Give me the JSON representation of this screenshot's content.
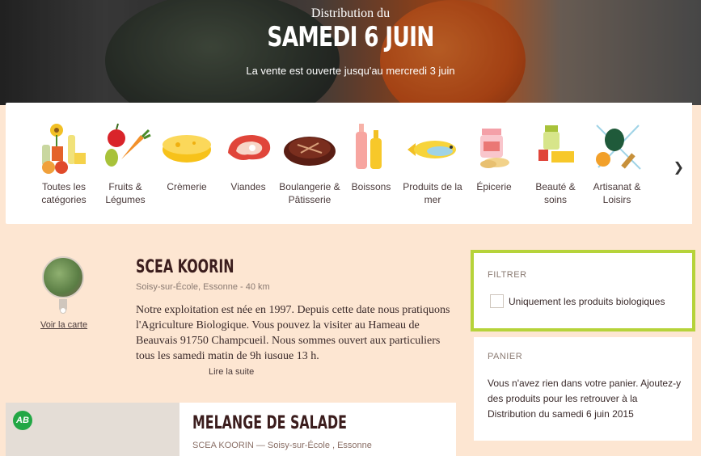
{
  "hero": {
    "kicker": "Distribution du",
    "title": "SAMEDI 6 JUIN",
    "subtitle": "La vente est ouverte jusqu'au mercredi 3 juin"
  },
  "categories": [
    {
      "label": "Toutes les catégories",
      "icon": "all-categories-icon"
    },
    {
      "label": "Fruits & Légumes",
      "icon": "fruits-vegetables-icon"
    },
    {
      "label": "Crèmerie",
      "icon": "cheese-icon"
    },
    {
      "label": "Viandes",
      "icon": "meat-icon"
    },
    {
      "label": "Boulangerie & Pâtisserie",
      "icon": "bread-icon"
    },
    {
      "label": "Boissons",
      "icon": "bottles-icon"
    },
    {
      "label": "Produits de la mer",
      "icon": "fish-icon"
    },
    {
      "label": "Épicerie",
      "icon": "jar-icon"
    },
    {
      "label": "Beauté & soins",
      "icon": "beauty-icon"
    },
    {
      "label": "Artisanat & Loisirs",
      "icon": "crafts-icon"
    }
  ],
  "producer": {
    "name": "SCEA KOORIN",
    "location": "Soisy-sur-École, Essonne - 40 km",
    "map_link": "Voir la carte",
    "description": "Notre exploitation est née en 1997. Depuis cette date nous pratiquons l'Agriculture Biologique. Vous pouvez la visiter au Hameau de Beauvais 91750 Champcueil. Nous sommes ouvert aux particuliers tous les samedi matin de 9h jusque 13 h.",
    "read_more": "Lire la suite"
  },
  "product": {
    "badge": "AB",
    "name": "MELANGE DE SALADE",
    "meta": "SCEA KOORIN — Soisy-sur-École , Essonne"
  },
  "filter": {
    "heading": "FILTRER",
    "organic_label": "Uniquement les produits biologiques",
    "organic_checked": false
  },
  "cart": {
    "heading": "PANIER",
    "text": "Vous n'avez rien dans votre panier. Ajoutez-y des produits pour les retrouver à la Distribution du samedi 6 juin 2015"
  },
  "colors": {
    "background": "#fde6d2",
    "title_brown": "#3b1d1d",
    "highlight_green": "#b6d33a",
    "organic_green": "#22a745"
  }
}
